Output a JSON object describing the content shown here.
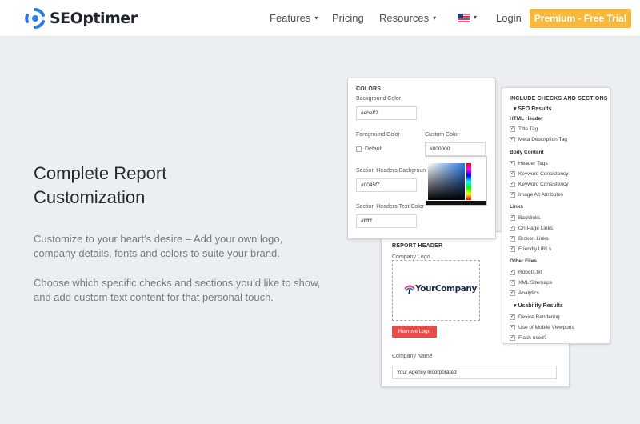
{
  "nav": {
    "brand": "SEOptimer",
    "items": [
      {
        "label": "Features",
        "caret": "▾"
      },
      {
        "label": "Pricing"
      },
      {
        "label": "Resources",
        "caret": "▾"
      }
    ],
    "flag_caret": "▾",
    "login": "Login",
    "cta": "Premium - Free Trial"
  },
  "hero": {
    "title": "Complete Report Customization",
    "p1": "Customize to your heart’s desire – Add your own logo, company details, fonts and colors to suite your brand.",
    "p2": "Choose which specific checks and sections you’d like to show, and add custom text content for that personal touch."
  },
  "colors_card": {
    "title": "COLORS",
    "bg_label": "Background Color",
    "bg_value": "#ebeff2",
    "fg_label": "Foreground Color",
    "default_label": "Default",
    "custom_label": "Custom Color",
    "custom_value": "#000000",
    "sh_bg_label": "Section Headers Background",
    "sh_bg_value": "#0045f7",
    "sh_text_label": "Section Headers Text Color",
    "sh_text_value": "#ffffff"
  },
  "report_card": {
    "title": "REPORT HEADER",
    "logo_label": "Company Logo",
    "logo_text": "YourCompany",
    "remove": "Remove Logo",
    "name_label": "Company Name",
    "name_value": "Your Agency Incorporated"
  },
  "checks_card": {
    "title": "INCLUDE CHECKS AND SECTIONS",
    "sec1": "SEO Results",
    "sec1_caret": "▾",
    "g_html": "HTML Header",
    "title_tag": "Title Tag",
    "meta_desc": "Meta Description Tag",
    "g_body": "Body Content",
    "header_tags": "Header Tags",
    "kw1": "Keyword Consistency",
    "kw2": "Keyword Consistency",
    "img_alt": "Image Alt Attributes",
    "g_links": "Links",
    "backlinks": "Backlinks",
    "onpage": "On-Page Links",
    "broken": "Broken Links",
    "friendly": "Friendly URLs",
    "g_other": "Other Files",
    "robots": "Robots.txt",
    "xml": "XML Sitemaps",
    "analytics": "Analytics",
    "sec2": "Usability Results",
    "sec2_caret": "▾",
    "device": "Device Rendering",
    "mobile": "Use of Mobile Viewports",
    "flash": "Flash used?",
    "check_glyph": "✓"
  },
  "colors": {
    "accent": "#f6b93b",
    "brand_blue": "#2c7be5",
    "remove_red": "#e94b4b",
    "page_bg": "#ebeff2"
  }
}
